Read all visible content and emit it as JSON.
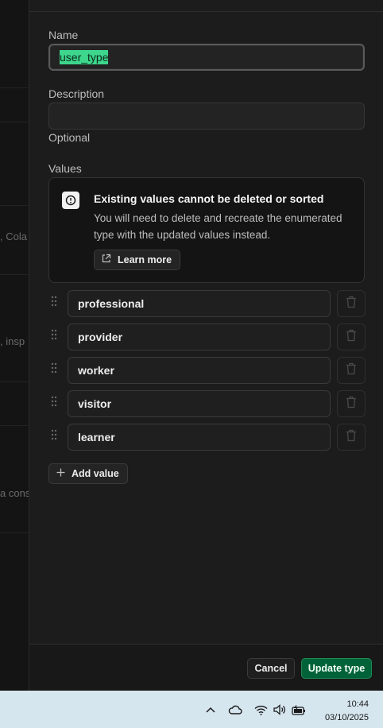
{
  "background_fragments": [
    ", Cola",
    ", insp",
    "a cons"
  ],
  "form": {
    "name_label": "Name",
    "name_value": "user_type",
    "description_label": "Description",
    "description_value": "",
    "description_hint": "Optional",
    "values_label": "Values"
  },
  "notice": {
    "icon": "info-icon",
    "title": "Existing values cannot be deleted or sorted",
    "body": "You will need to delete and recreate the enumerated type with the updated values instead.",
    "learn_more_label": "Learn more"
  },
  "values": [
    "professional",
    "provider",
    "worker",
    "visitor",
    "learner"
  ],
  "add_value_label": "Add value",
  "footer": {
    "cancel_label": "Cancel",
    "update_label": "Update type"
  },
  "taskbar": {
    "time": "10:44",
    "date": "03/10/2025"
  },
  "colors": {
    "accent": "#006239",
    "highlight": "#3dd68c",
    "panel_bg": "#1c1c1c"
  }
}
